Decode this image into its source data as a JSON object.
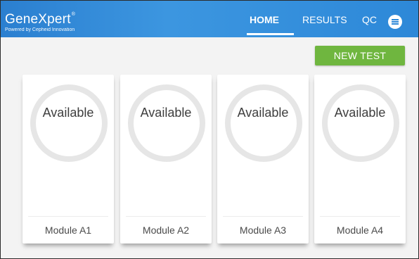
{
  "brand": {
    "name": "GeneXpert",
    "mark": "®",
    "tagline": "Powered by Cepheid Innovation"
  },
  "nav": {
    "home": "HOME",
    "results": "RESULTS",
    "qc": "QC",
    "active": "HOME",
    "menu_icon": "hamburger-menu-icon"
  },
  "actions": {
    "new_test": "NEW TEST"
  },
  "colors": {
    "header": "#2d88d8",
    "accent_green": "#6fb63f",
    "ring": "#e6e6e6"
  },
  "modules": [
    {
      "status": "Available",
      "label": "Module A1"
    },
    {
      "status": "Available",
      "label": "Module A2"
    },
    {
      "status": "Available",
      "label": "Module A3"
    },
    {
      "status": "Available",
      "label": "Module A4"
    }
  ]
}
